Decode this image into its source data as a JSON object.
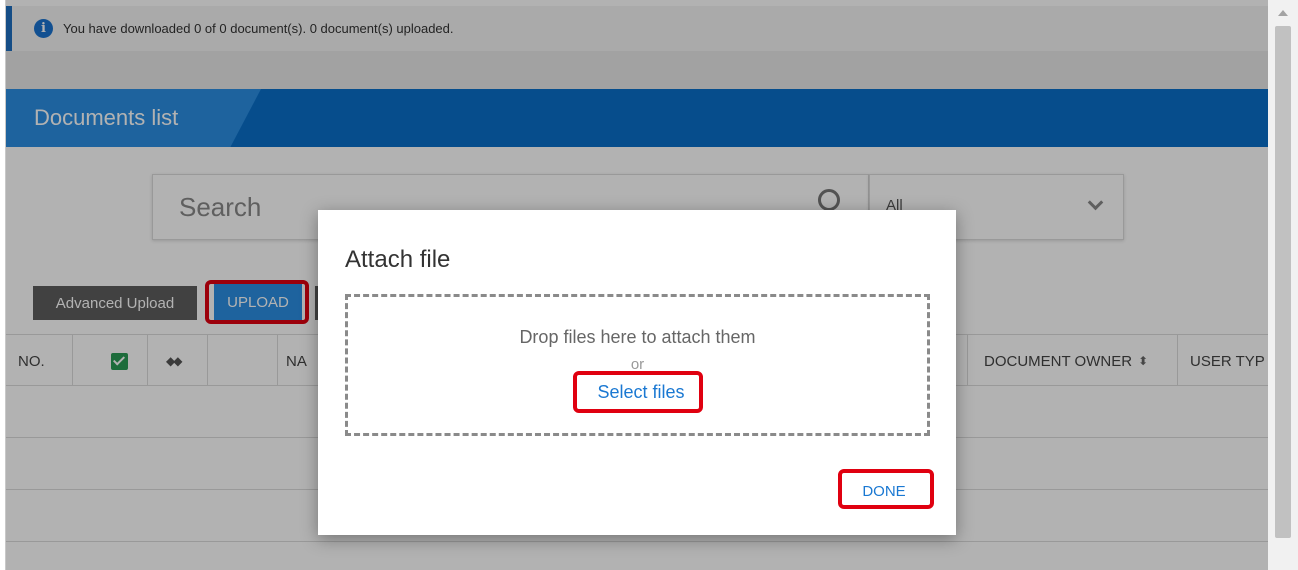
{
  "info": {
    "icon": "info-icon",
    "text": "You have downloaded 0 of 0 document(s). 0 document(s) uploaded."
  },
  "documents": {
    "title": "Documents list",
    "header_color": "#0a6fc9"
  },
  "search": {
    "placeholder": "Search",
    "filter_value": "All"
  },
  "toolbar": {
    "advanced_upload": "Advanced Upload",
    "upload": "UPLOAD"
  },
  "table": {
    "headers": {
      "no": "NO.",
      "name": "NA",
      "document_owner": "DOCUMENT OWNER",
      "user_type": "USER TYP"
    },
    "row_count_visible": 3
  },
  "modal": {
    "title": "Attach file",
    "drop_text": "Drop files here to attach them",
    "or": "or",
    "select_files": "Select files",
    "done": "DONE"
  },
  "colors": {
    "accent": "#2b8fe3",
    "highlight": "#e00010",
    "checkbox": "#2a9b55"
  }
}
